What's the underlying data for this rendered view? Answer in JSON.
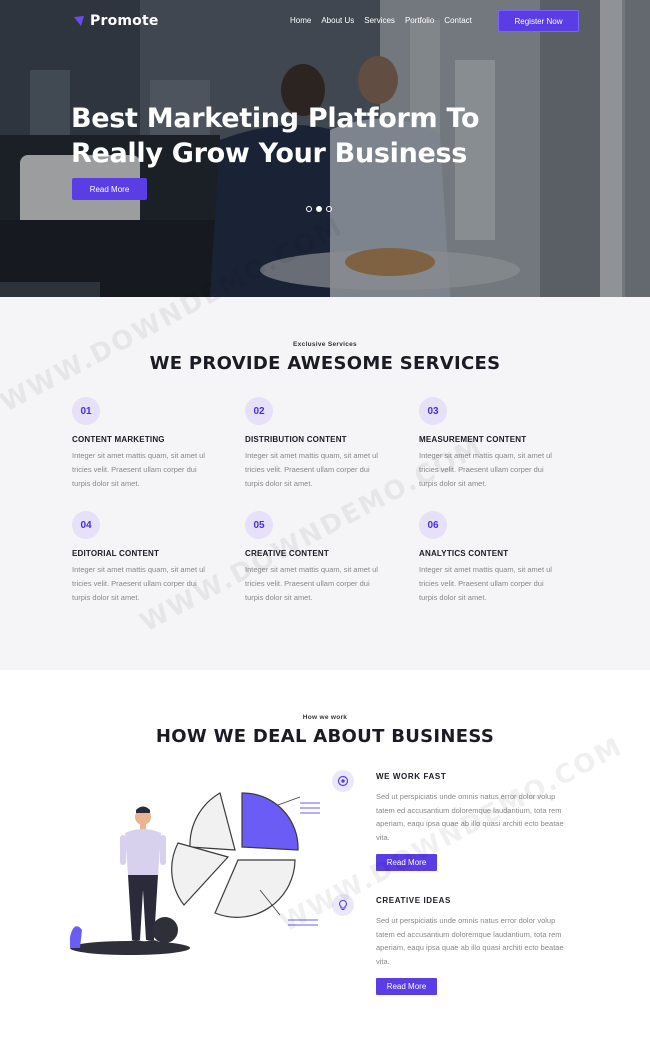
{
  "nav": {
    "logo_text": "Promote",
    "links": [
      "Home",
      "About Us",
      "Services",
      "Portfolio",
      "Contact"
    ],
    "cta_label": "Register Now"
  },
  "hero": {
    "title_line1": "Best Marketing Platform To",
    "title_line2": "Really Grow Your Business",
    "button_label": "Read More",
    "slide_count": 3,
    "active_slide": 2
  },
  "services": {
    "eyebrow": "Exclusive Services",
    "title": "WE PROVIDE AWESOME SERVICES",
    "items": [
      {
        "num": "01",
        "title": "CONTENT MARKETING",
        "text": "Integer sit amet mattis quam, sit amet ul tricies velit. Praesent ullam corper dui turpis dolor sit amet."
      },
      {
        "num": "02",
        "title": "DISTRIBUTION CONTENT",
        "text": "Integer sit amet mattis quam, sit amet ul tricies velit. Praesent ullam corper dui turpis dolor sit amet."
      },
      {
        "num": "03",
        "title": "MEASUREMENT CONTENT",
        "text": "Integer sit amet mattis quam, sit amet ul tricies velit. Praesent ullam corper dui turpis dolor sit amet."
      },
      {
        "num": "04",
        "title": "EDITORIAL CONTENT",
        "text": "Integer sit amet mattis quam, sit amet ul tricies velit. Praesent ullam corper dui turpis dolor sit amet."
      },
      {
        "num": "05",
        "title": "CREATIVE CONTENT",
        "text": "Integer sit amet mattis quam, sit amet ul tricies velit. Praesent ullam corper dui turpis dolor sit amet."
      },
      {
        "num": "06",
        "title": "ANALYTICS CONTENT",
        "text": "Integer sit amet mattis quam, sit amet ul tricies velit. Praesent ullam corper dui turpis dolor sit amet."
      }
    ]
  },
  "how": {
    "eyebrow": "How we work",
    "title": "HOW WE DEAL ABOUT BUSINESS",
    "features": [
      {
        "icon": "target-icon",
        "title": "WE WORK FAST",
        "text": "Sed ut perspiciatis unde omnis natus error dolor volup tatem ed accusantium doloremque laudantium, tota rem aperiam, eaqu ipsa quae ab illo quasi architi ecto beatae vita.",
        "button_label": "Read More"
      },
      {
        "icon": "lightbulb-icon",
        "title": "CREATIVE IDEAS",
        "text": "Sed ut perspiciatis unde omnis natus error dolor volup tatem ed accusantium doloremque laudantium, tota rem aperiam, eaqu ipsa quae ab illo quasi architi ecto beatae vita.",
        "button_label": "Read More"
      }
    ]
  },
  "watermark": "WWW.DOWNDEMO.COM",
  "colors": {
    "accent": "#5b3de6",
    "accent_light": "#e6e0f8",
    "section_bg": "#f5f5f7",
    "text_dark": "#1b1b24",
    "text_muted": "#888888"
  }
}
